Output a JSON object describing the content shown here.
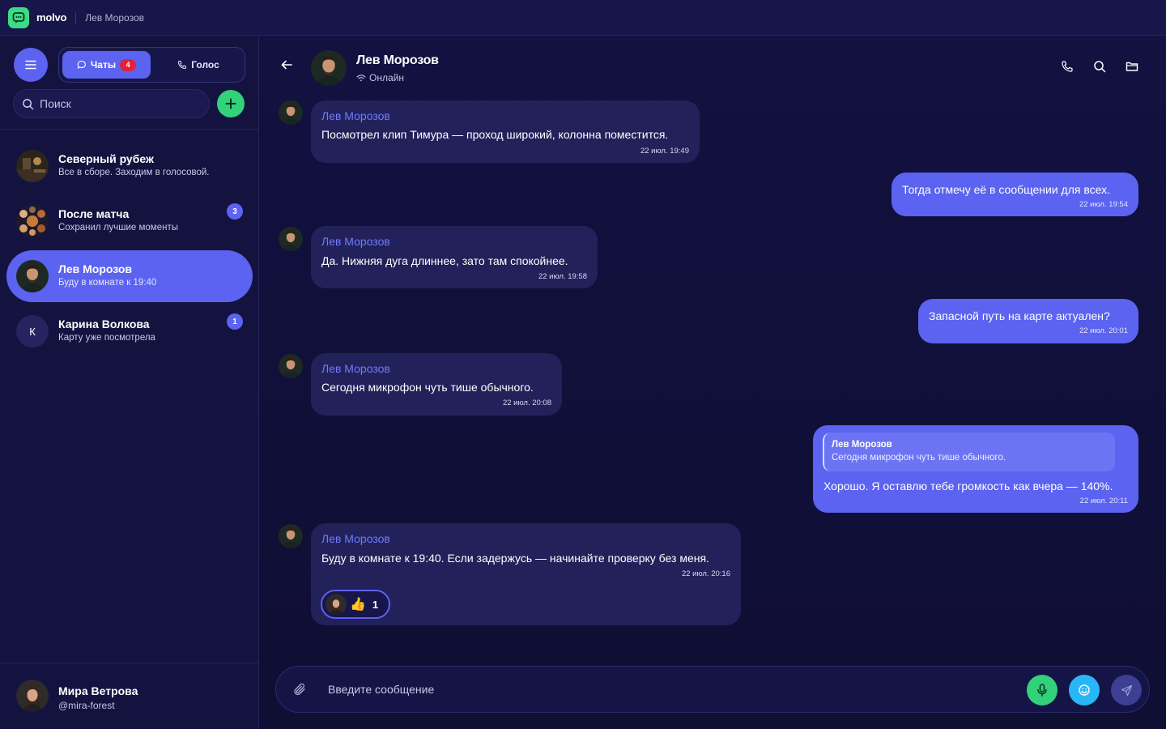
{
  "app": {
    "brand": "molvo",
    "window_title": "Лев Морозов"
  },
  "sidebar": {
    "tabs": [
      {
        "label": "Чаты",
        "badge": "4"
      },
      {
        "label": "Голос"
      }
    ],
    "search_placeholder": "Поиск",
    "chats": [
      {
        "name": "Северный рубеж",
        "last": "Все в сборе. Заходим в голосовой.",
        "unread": ""
      },
      {
        "name": "После матча",
        "last": "Сохранил лучшие моменты",
        "unread": "3"
      },
      {
        "name": "Лев Морозов",
        "last": "Буду в комнате к 19:40",
        "unread": ""
      },
      {
        "name": "Карина Волкова",
        "last": "Карту уже посмотрела",
        "unread": "1",
        "initial": "К"
      }
    ],
    "profile": {
      "name": "Мира Ветрова",
      "handle": "@mira-forest"
    }
  },
  "chat": {
    "name": "Лев Морозов",
    "status": "Онлайн",
    "messages": [
      {
        "dir": "in",
        "author": "Лев Морозов",
        "text": "Посмотрел клип Тимура — проход широкий, колонна поместится.",
        "time": "22 июл. 19:49"
      },
      {
        "dir": "out",
        "text": "Тогда отмечу её в сообщении для всех.",
        "time": "22 июл. 19:54"
      },
      {
        "dir": "in",
        "author": "Лев Морозов",
        "text": "Да. Нижняя дуга длиннее, зато там спокойнее.",
        "time": "22 июл. 19:58"
      },
      {
        "dir": "out",
        "text": "Запасной путь на карте актуален?",
        "time": "22 июл. 20:01"
      },
      {
        "dir": "in",
        "author": "Лев Морозов",
        "text": "Сегодня микрофон чуть тише обычного.",
        "time": "22 июл. 20:08"
      },
      {
        "dir": "out",
        "reply_author": "Лев Морозов",
        "reply_text": "Сегодня микрофон чуть тише обычного.",
        "text": "Хорошо. Я оставлю тебе громкость как вчера — 140%.",
        "time": "22 июл. 20:11"
      },
      {
        "dir": "in",
        "author": "Лев Морозов",
        "text": "Буду в комнате к 19:40. Если задержусь — начинайте проверку без меня.",
        "time": "22 июл. 20:16",
        "reaction": {
          "emoji": "👍",
          "count": "1"
        }
      }
    ]
  },
  "composer": {
    "placeholder": "Введите сообщение"
  },
  "colors": {
    "accent": "#5b63f0",
    "green": "#33d17a",
    "cyan": "#29b6f6",
    "badge": "#e5213a",
    "author": "#6f7bff"
  }
}
